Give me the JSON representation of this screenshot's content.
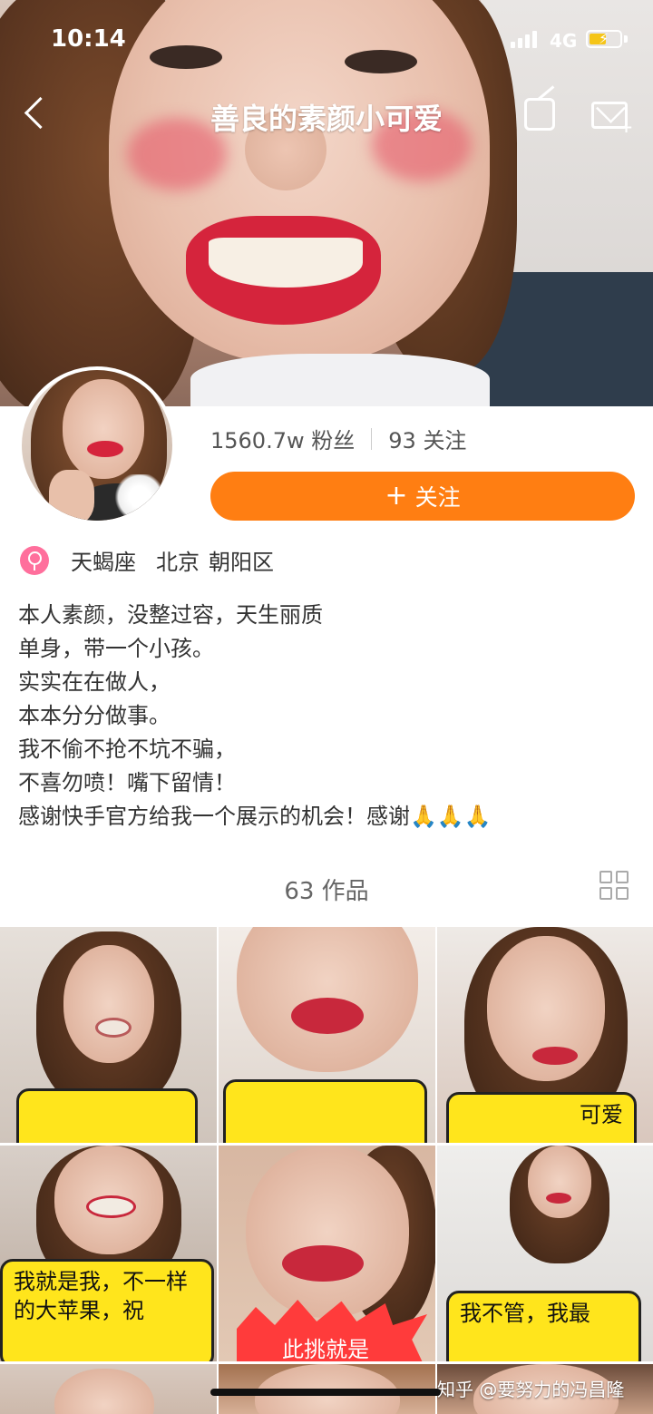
{
  "status_bar": {
    "time": "10:14",
    "network": "4G"
  },
  "nav": {
    "title": "善良的素颜小可爱"
  },
  "profile": {
    "fans_count": "1560.7w",
    "fans_label": "粉丝",
    "following_count": "93",
    "following_label": "关注",
    "follow_button": "关注",
    "constellation": "天蝎座",
    "city": "北京",
    "district": "朝阳区",
    "bio": [
      "本人素颜，没整过容，天生丽质",
      "单身，带一个小孩。",
      "实实在在做人，",
      "本本分分做事。",
      "我不偷不抢不坑不骗，",
      "不喜勿喷！嘴下留情！",
      "感谢快手官方给我一个展示的机会！感谢🙏🙏🙏"
    ]
  },
  "works": {
    "count": "63",
    "label": "作品",
    "thumbnails": [
      {
        "caption": ""
      },
      {
        "caption": ""
      },
      {
        "caption": "可爱"
      },
      {
        "caption": "我就是我，不一样的大苹果，祝"
      },
      {
        "caption": "此挑就是"
      },
      {
        "caption": "我不管，我最"
      }
    ]
  },
  "watermark": "知乎 @要努力的冯昌隆",
  "colors": {
    "accent": "#ff7e12",
    "gender": "#ff6f9c",
    "caption_bg": "#ffe51c"
  }
}
